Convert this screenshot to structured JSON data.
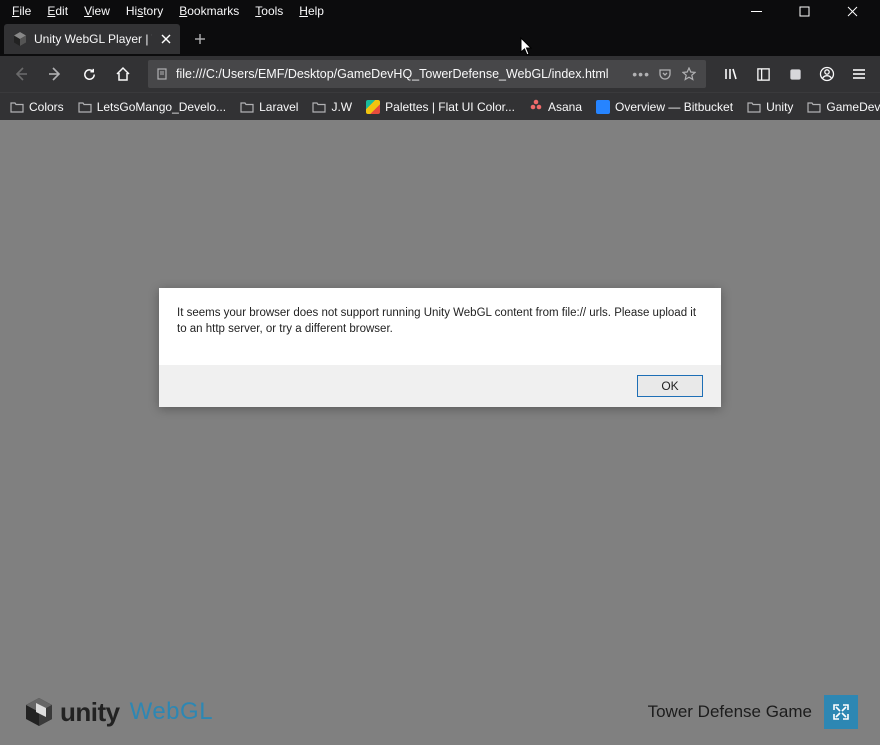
{
  "menu": {
    "file": "File",
    "edit": "Edit",
    "view": "View",
    "history": "History",
    "bookmarks": "Bookmarks",
    "tools": "Tools",
    "help": "Help"
  },
  "tab": {
    "title": "Unity WebGL Player | Tower Def"
  },
  "url": "file:///C:/Users/EMF/Desktop/GameDevHQ_TowerDefense_WebGL/index.html",
  "url_dots": "•••",
  "bookmarks": {
    "b0": "Colors",
    "b1": "LetsGoMango_Develo...",
    "b2": "Laravel",
    "b3": "J.W",
    "b4": "Palettes | Flat UI Color...",
    "b5": "Asana",
    "b6": "Overview — Bitbucket",
    "b7": "Unity",
    "b8": "GameDevHQ"
  },
  "dialog": {
    "message": "It seems your browser does not support running Unity WebGL content from file:// urls. Please upload it to an http server, or try a different browser.",
    "ok": "OK"
  },
  "footer": {
    "unity": "unity",
    "webgl": "WebGL",
    "game_title": "Tower Defense Game"
  }
}
